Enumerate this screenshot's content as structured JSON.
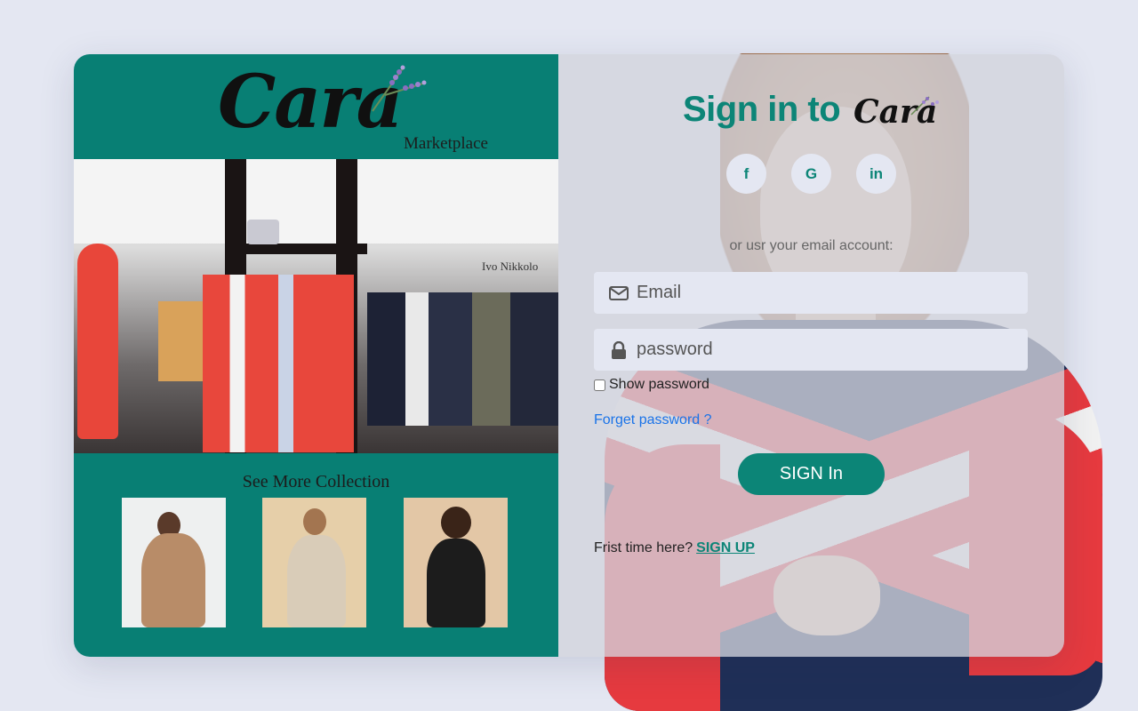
{
  "brand": {
    "logo_text": "Cara",
    "tagline": "Marketplace"
  },
  "left_panel": {
    "store_photo_sign": "Ivo Nikkolo",
    "see_more": "See More Collection",
    "thumbnails": [
      {
        "name": "beige-trench-coat-model"
      },
      {
        "name": "beige-outfit-seated-model"
      },
      {
        "name": "black-shirt-curly-hair-model"
      }
    ]
  },
  "signin": {
    "title": "Sign in to",
    "logo_text": "Cara",
    "social": [
      {
        "label": "f",
        "icon": "facebook-icon"
      },
      {
        "label": "G",
        "icon": "google-icon"
      },
      {
        "label": "in",
        "icon": "linkedin-icon"
      }
    ],
    "or_text": "or usr your email account:",
    "email_placeholder": "Email",
    "password_placeholder": "password",
    "show_password_label": "Show password",
    "forget_password": "Forget password ?",
    "signin_button": "SIGN In",
    "first_time_text": "Frist time here?",
    "signup_link": "SIGN UP"
  },
  "colors": {
    "accent": "#0c8577",
    "left_panel_bg": "#087f74",
    "page_bg": "#e4e7f2",
    "link_blue": "#1a73e8"
  }
}
